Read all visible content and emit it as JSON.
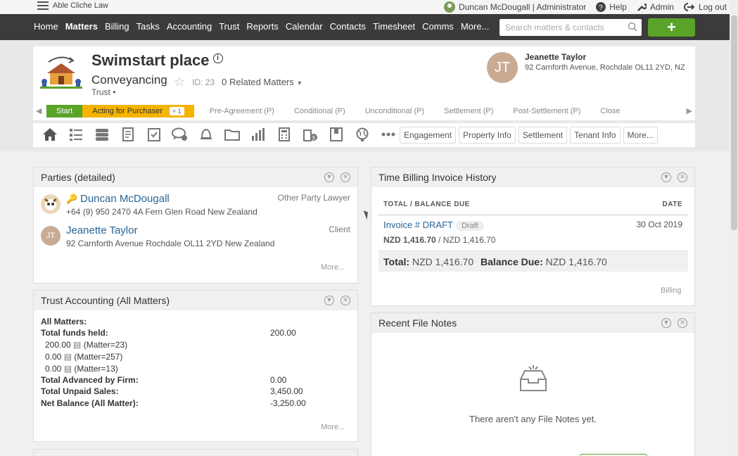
{
  "topbar": {
    "brand": "Able Cliche Law",
    "user": "Duncan McDougall | Administrator",
    "help": "Help",
    "admin": "Admin",
    "logout": "Log out"
  },
  "nav": {
    "items": [
      "Home",
      "Matters",
      "Billing",
      "Tasks",
      "Accounting",
      "Trust",
      "Reports",
      "Calendar",
      "Contacts",
      "Timesheet",
      "Comms",
      "More..."
    ],
    "active": "Matters",
    "search_placeholder": "Search matters & contacts",
    "add_label": "+"
  },
  "matter": {
    "title": "Swimstart place",
    "type": "Conveyancing",
    "id": "ID: 23",
    "related": "0 Related Matters",
    "trust": "Trust •"
  },
  "client": {
    "initials": "JT",
    "name": "Jeanette Taylor",
    "address": "92 Carnforth Avenue, Rochdale OL11 2YD, NZ"
  },
  "stages": {
    "start": "Start",
    "current": "Acting for Purchaser",
    "current_count": "+ 1",
    "others": [
      "Pre-Agreement (P)",
      "Conditional (P)",
      "Unconditional (P)",
      "Settlement (P)",
      "Post-Settlement (P)",
      "Close"
    ]
  },
  "toolbar": {
    "icons": [
      "home-icon",
      "list-icon",
      "stack-icon",
      "document-icon",
      "checklist-icon",
      "chat-icon",
      "bell-icon",
      "folder-icon",
      "chart-icon",
      "calculator-icon",
      "money-icon",
      "book-icon",
      "globe-icon",
      "ellipsis-icon"
    ],
    "tabs": [
      "Engagement",
      "Property Info",
      "Settlement",
      "Tenant Info",
      "More..."
    ]
  },
  "parties": {
    "title": "Parties (detailed)",
    "items": [
      {
        "name": "Duncan McDougall",
        "address": "+64 (9) 950 2470 4A Fern Glen Road New Zealand",
        "role": "Other Party Lawyer"
      },
      {
        "name": "Jeanette Taylor",
        "address": "92 Carnforth Avenue Rochdale OL11 2YD New Zealand",
        "role": "Client",
        "initials": "JT"
      }
    ],
    "more": "More..."
  },
  "trust_acc": {
    "title": "Trust Accounting (All Matters)",
    "all_matters": "All Matters:",
    "total_funds_label": "Total funds held:",
    "total_funds_value": "200.00",
    "lines": [
      {
        "amount": "200.00",
        "ref": "(Matter=23)"
      },
      {
        "amount": "0.00",
        "ref": "(Matter=257)"
      },
      {
        "amount": "0.00",
        "ref": "(Matter=13)"
      }
    ],
    "advanced_label": "Total Advanced by Firm:",
    "advanced_value": "0.00",
    "unpaid_label": "Total Unpaid Sales:",
    "unpaid_value": "3,450.00",
    "net_label": "Net Balance (All Matter):",
    "net_value": "-3,250.00",
    "more": "More..."
  },
  "billing": {
    "title": "Time Billing Invoice History",
    "col_total": "TOTAL / BALANCE DUE",
    "col_date": "DATE",
    "invoice": "Invoice # DRAFT",
    "badge": "Draft",
    "date": "30 Oct 2019",
    "amount_total": "NZD 1,416.70",
    "amount_sep": " / ",
    "amount_balance": "NZD 1,416.70",
    "total_label": "Total:",
    "total_value": "NZD 1,416.70",
    "balance_label": "Balance Due:",
    "balance_value": "NZD 1,416.70",
    "link": "Billing"
  },
  "filenotes": {
    "title": "Recent File Notes",
    "empty": "There aren't any File Notes yet."
  }
}
